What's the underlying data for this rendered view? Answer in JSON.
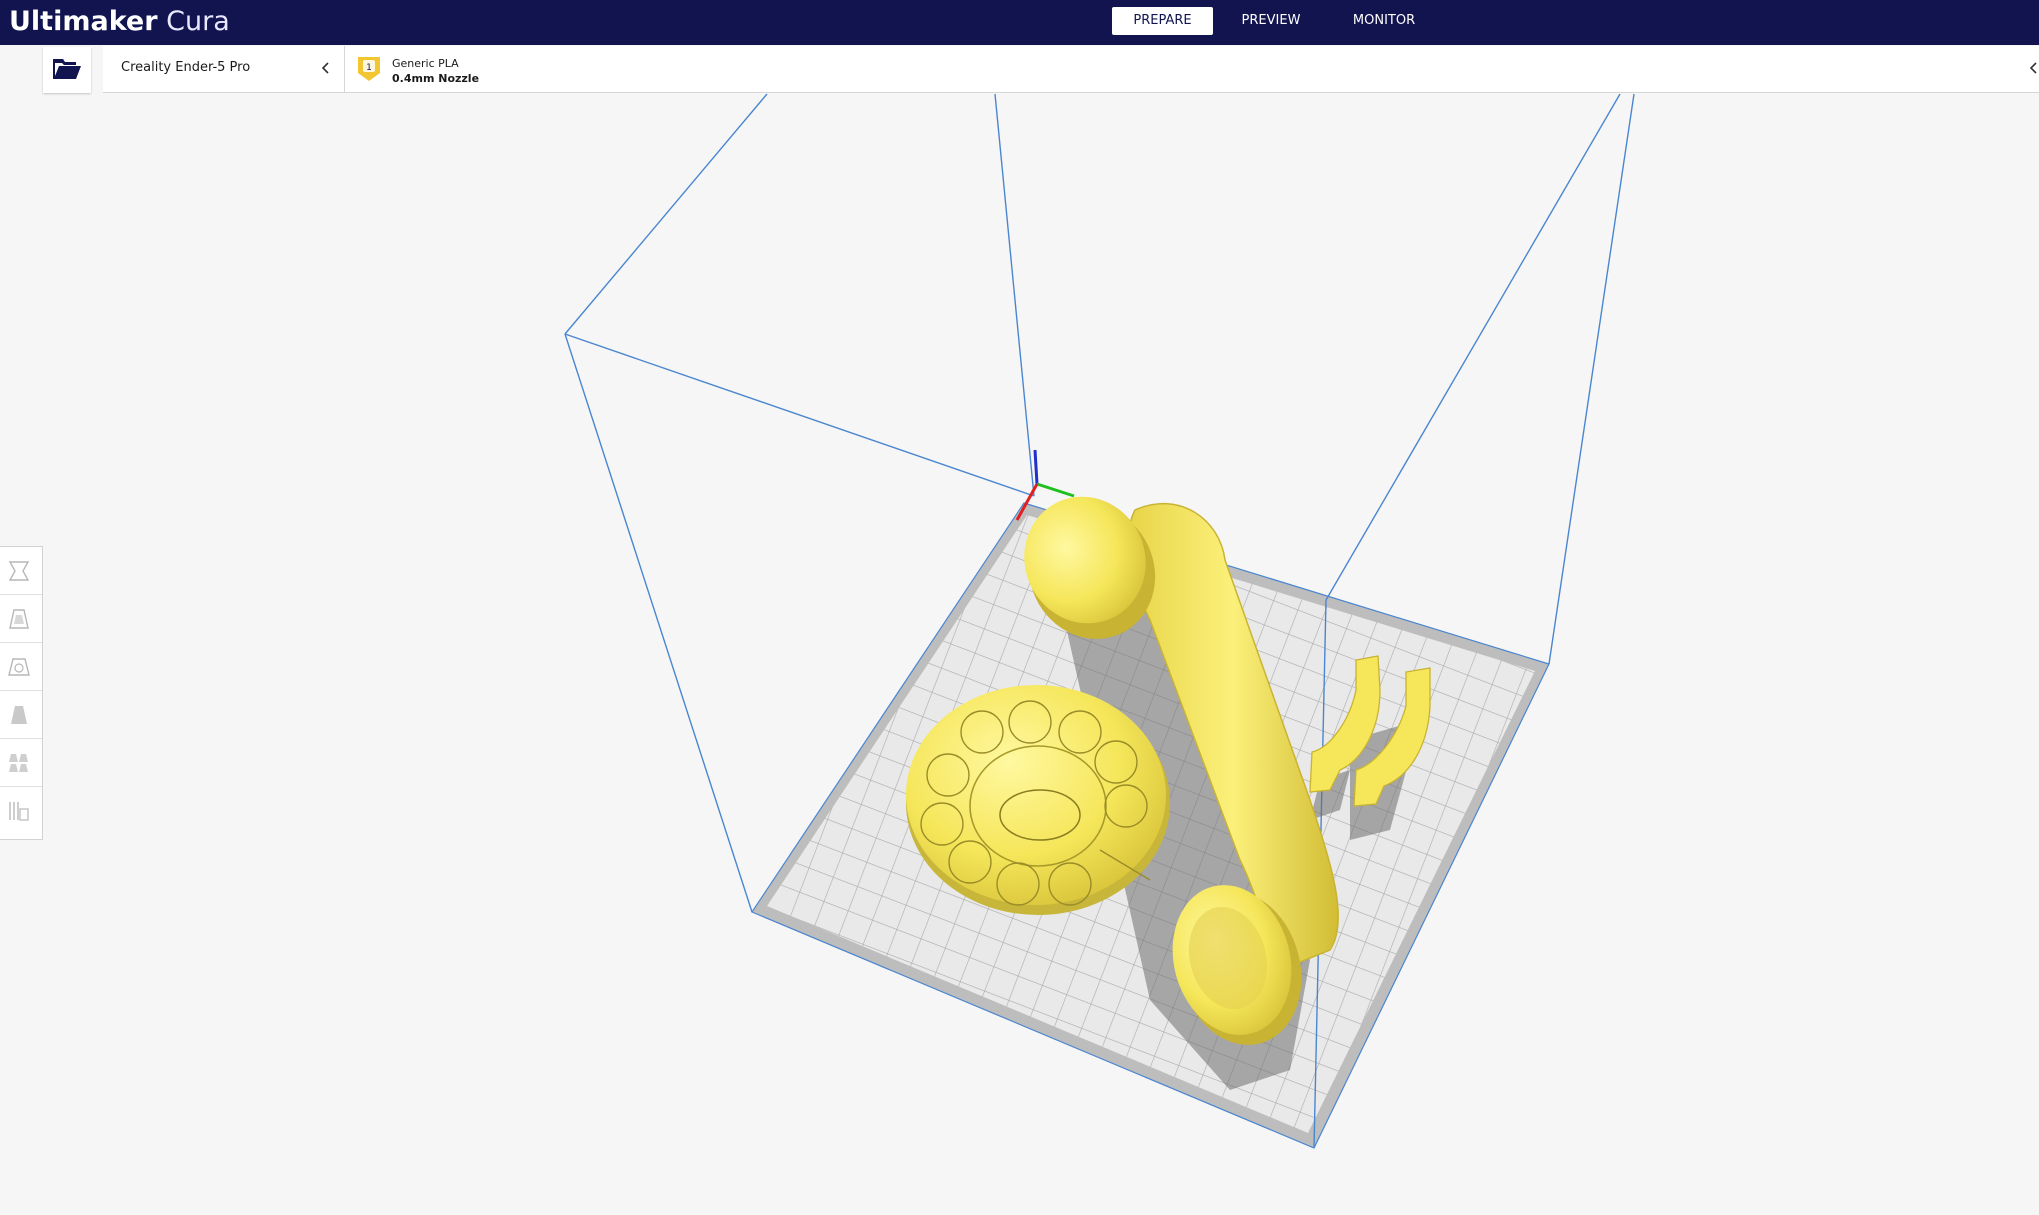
{
  "app": {
    "brand_bold": "Ultimaker",
    "brand_thin": "Cura"
  },
  "stages": [
    {
      "label": "PREPARE",
      "active": true
    },
    {
      "label": "PREVIEW",
      "active": false
    },
    {
      "label": "MONITOR",
      "active": false
    }
  ],
  "printer": {
    "name": "Creality Ender-5 Pro"
  },
  "extruder": {
    "index": "1",
    "material": "Generic PLA",
    "nozzle": "0.4mm Nozzle",
    "material_color": "#f2c630"
  },
  "colors": {
    "header": "#121450",
    "model": "#f5e65a",
    "build_volume_outline": "#4a86d0",
    "viewport_bg": "#f6f6f6"
  },
  "icons": {
    "open": "folder-open-icon",
    "printer_chevron": "chevron-left-icon",
    "material_chevron": "chevron-left-icon",
    "tools": [
      "move-icon",
      "scale-icon",
      "rotate-icon",
      "mirror-icon",
      "per-model-settings-icon",
      "support-blocker-icon"
    ]
  }
}
